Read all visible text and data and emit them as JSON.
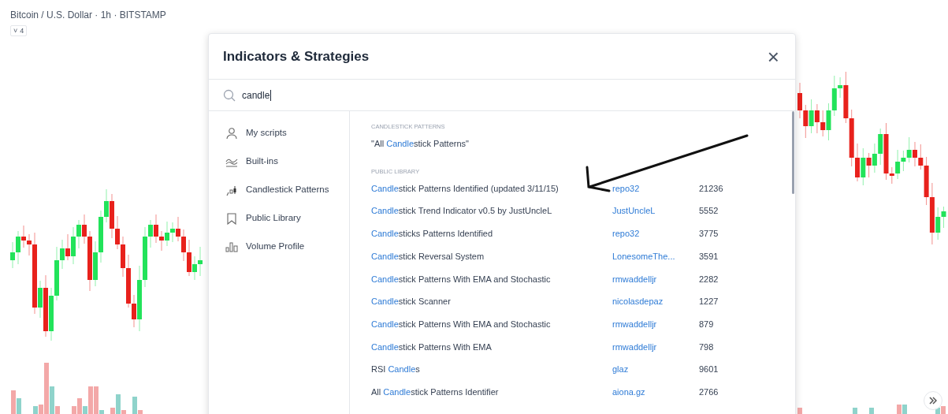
{
  "chart_header": {
    "title": "Bitcoin / U.S. Dollar · 1h · BITSTAMP",
    "collapse_button": {
      "icon": "˅",
      "count": "4"
    }
  },
  "dialog": {
    "title": "Indicators & Strategies",
    "close": "×",
    "search": {
      "value": "candle"
    },
    "sidebar": {
      "items": [
        {
          "label": "My scripts",
          "kind": "user",
          "selected": false
        },
        {
          "label": "Built-ins",
          "kind": "builtin",
          "selected": false
        },
        {
          "label": "Candlestick Patterns",
          "kind": "candles",
          "selected": false
        },
        {
          "label": "Public Library",
          "kind": "bookmark",
          "selected": false
        },
        {
          "label": "Volume Profile",
          "kind": "volume",
          "selected": false
        }
      ]
    },
    "sections": [
      {
        "heading": "CANDLESTICK PATTERNS",
        "items": [
          {
            "title_parts": [
              {
                "text": "\"All ",
                "match": false
              },
              {
                "text": "Candle",
                "match": true
              },
              {
                "text": "stick Patterns\"",
                "match": false
              }
            ]
          }
        ]
      },
      {
        "heading": "PUBLIC LIBRARY",
        "items": [
          {
            "title_parts": [
              {
                "text": "Candle",
                "match": true
              },
              {
                "text": "stick Patterns Identified (updated 3/11/15)",
                "match": false
              }
            ],
            "author": "repo32",
            "count": "21236"
          },
          {
            "title_parts": [
              {
                "text": "Candle",
                "match": true
              },
              {
                "text": "stick Trend Indicator v0.5 by JustUncleL",
                "match": false
              }
            ],
            "author": "JustUncleL",
            "count": "5552"
          },
          {
            "title_parts": [
              {
                "text": "Candle",
                "match": true
              },
              {
                "text": "sticks Patterns Identified",
                "match": false
              }
            ],
            "author": "repo32",
            "count": "3775"
          },
          {
            "title_parts": [
              {
                "text": "Candle",
                "match": true
              },
              {
                "text": "stick Reversal System",
                "match": false
              }
            ],
            "author": "LonesomeThe...",
            "count": "3591"
          },
          {
            "title_parts": [
              {
                "text": "Candle",
                "match": true
              },
              {
                "text": "stick Patterns With EMA and Stochastic",
                "match": false
              }
            ],
            "author": "rmwaddelljr",
            "count": "2282"
          },
          {
            "title_parts": [
              {
                "text": "Candle",
                "match": true
              },
              {
                "text": "stick Scanner",
                "match": false
              }
            ],
            "author": "nicolasdepaz",
            "count": "1227"
          },
          {
            "title_parts": [
              {
                "text": "Candle",
                "match": true
              },
              {
                "text": "stick Patterns With EMA and Stochastic",
                "match": false
              }
            ],
            "author": "rmwaddelljr",
            "count": "879"
          },
          {
            "title_parts": [
              {
                "text": "Candle",
                "match": true
              },
              {
                "text": "stick Patterns With EMA",
                "match": false
              }
            ],
            "author": "rmwaddelljr",
            "count": "798"
          },
          {
            "title_parts": [
              {
                "text": "RSI ",
                "match": false
              },
              {
                "text": "Candle",
                "match": true
              },
              {
                "text": "s",
                "match": false
              }
            ],
            "author": "glaz",
            "count": "9601"
          },
          {
            "title_parts": [
              {
                "text": "All ",
                "match": false
              },
              {
                "text": "Candle",
                "match": true
              },
              {
                "text": "stick Patterns Identifier",
                "match": false
              }
            ],
            "author": "aiona.gz",
            "count": "2766"
          }
        ]
      }
    ]
  }
}
